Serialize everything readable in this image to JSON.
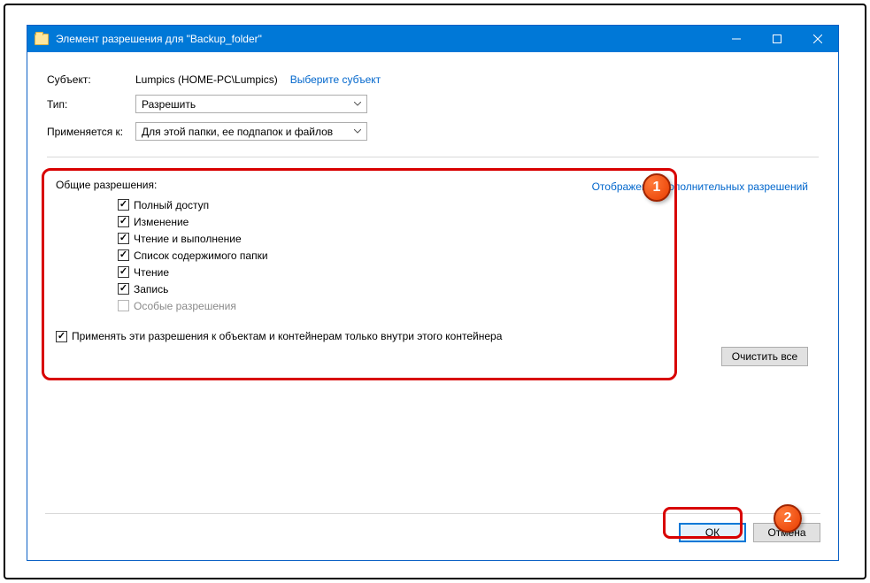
{
  "window": {
    "title": "Элемент разрешения для \"Backup_folder\""
  },
  "labels": {
    "subject": "Субъект:",
    "type": "Тип:",
    "applies": "Применяется к:"
  },
  "subject": {
    "value": "Lumpics (HOME-PC\\Lumpics)",
    "select_link": "Выберите субъект"
  },
  "type": {
    "selected": "Разрешить"
  },
  "applies": {
    "selected": "Для этой папки, ее подпапок и файлов"
  },
  "permissions": {
    "title": "Общие разрешения:",
    "items": [
      {
        "label": "Полный доступ",
        "checked": true,
        "enabled": true
      },
      {
        "label": "Изменение",
        "checked": true,
        "enabled": true
      },
      {
        "label": "Чтение и выполнение",
        "checked": true,
        "enabled": true
      },
      {
        "label": "Список содержимого папки",
        "checked": true,
        "enabled": true
      },
      {
        "label": "Чтение",
        "checked": true,
        "enabled": true
      },
      {
        "label": "Запись",
        "checked": true,
        "enabled": true
      },
      {
        "label": "Особые разрешения",
        "checked": false,
        "enabled": false
      }
    ],
    "apply_only_here": {
      "label": "Применять эти разрешения к объектам и контейнерам только внутри этого контейнера",
      "checked": true
    },
    "advanced_link": "Отображение дополнительных разрешений",
    "clear_all": "Очистить все"
  },
  "buttons": {
    "ok": "ОК",
    "cancel": "Отмена"
  },
  "annotations": {
    "badge1": "1",
    "badge2": "2"
  }
}
